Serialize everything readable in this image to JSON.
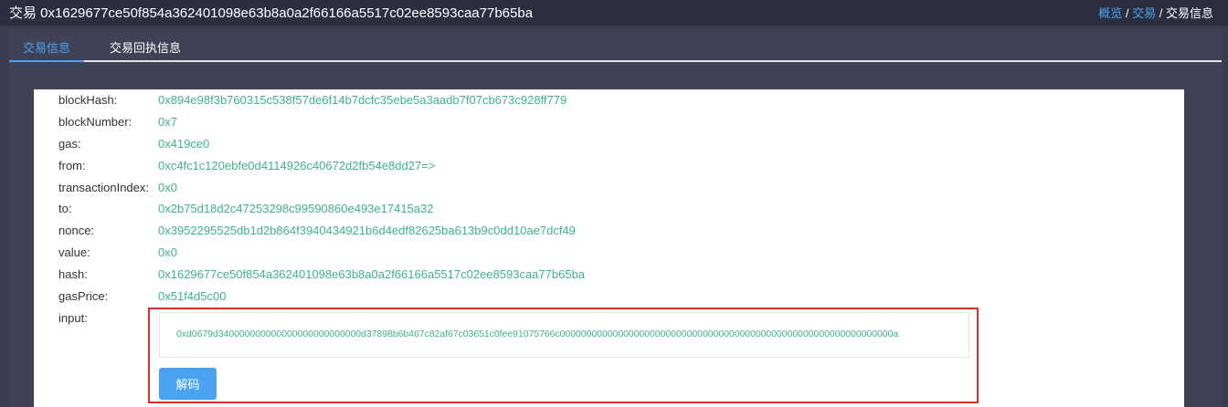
{
  "header": {
    "title": "交易 0x1629677ce50f854a362401098e63b8a0a2f66166a5517c02ee8593caa77b65ba",
    "breadcrumb": {
      "overview": "概览",
      "separator": "/",
      "transactions": "交易",
      "current": "交易信息"
    }
  },
  "tabs": [
    {
      "label": "交易信息",
      "active": true
    },
    {
      "label": "交易回执信息",
      "active": false
    }
  ],
  "fields": [
    {
      "key": "blockHash:",
      "value": "0x894e98f3b760315c538f57de6f14b7dcfc35ebe5a3aadb7f07cb673c928ff779"
    },
    {
      "key": "blockNumber:",
      "value": "0x7"
    },
    {
      "key": "gas:",
      "value": "0x419ce0"
    },
    {
      "key": "from:",
      "value": "0xc4fc1c120ebfe0d4114926c40672d2fb54e8dd27=>"
    },
    {
      "key": "transactionIndex:",
      "value": "0x0"
    },
    {
      "key": "to:",
      "value": "0x2b75d18d2c47253298c99590860e493e17415a32"
    },
    {
      "key": "nonce:",
      "value": "0x3952295525db1d2b864f3940434921b6d4edf82625ba613b9c0dd10ae7dcf49"
    },
    {
      "key": "value:",
      "value": "0x0"
    },
    {
      "key": "hash:",
      "value": "0x1629677ce50f854a362401098e63b8a0a2f66166a5517c02ee8593caa77b65ba"
    },
    {
      "key": "gasPrice:",
      "value": "0x51f4d5c00"
    }
  ],
  "input": {
    "key": "input:",
    "value": "0xd0679d340000000000000000000000000d37898b6b467c82af67c03651c0fee91075766c000000000000000000000000000000000000000000000000000000000000000a",
    "decode_label": "解码"
  },
  "colors": {
    "accent": "#4aa3f0",
    "value_green": "#3fb389",
    "highlight": "#d9302b",
    "background": "#3a3d51"
  }
}
